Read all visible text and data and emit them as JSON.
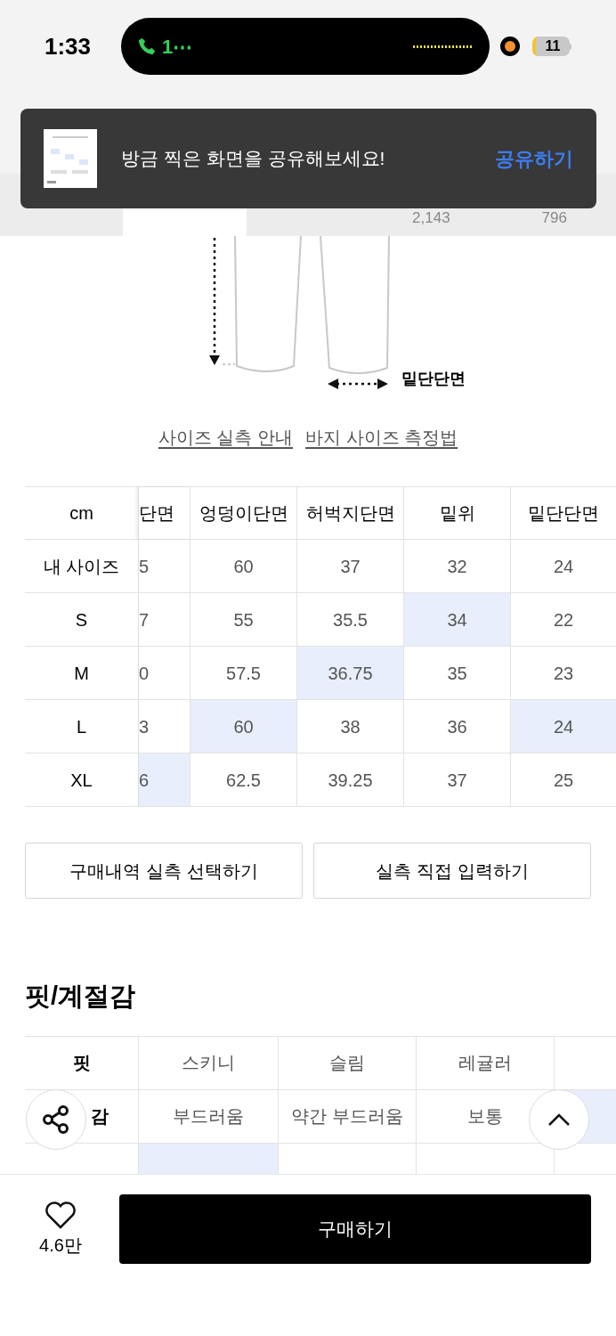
{
  "status_bar": {
    "time": "1:33",
    "call_text": "1⋯",
    "battery": "11"
  },
  "toast": {
    "message": "방금 찍은 화면을 공유해보세요!",
    "action": "공유하기"
  },
  "tabs": [
    {
      "selected": false
    },
    {
      "selected": true
    },
    {
      "selected": false
    },
    {
      "selected": false,
      "count": "2,143"
    },
    {
      "selected": false,
      "count": "796"
    }
  ],
  "diagram": {
    "label": "밑단단면"
  },
  "links": [
    "사이즈 실측 안내",
    "바지 사이즈 측정법"
  ],
  "size_table": {
    "corner": "cm",
    "columns": [
      "단면",
      "엉덩이단면",
      "허벅지단면",
      "밑위",
      "밑단단면"
    ],
    "rows": [
      {
        "label": "내 사이즈",
        "cells": [
          {
            "text": "5",
            "selected": false
          },
          {
            "text": "60",
            "selected": false
          },
          {
            "text": "37",
            "selected": false
          },
          {
            "text": "32",
            "selected": false
          },
          {
            "text": "24",
            "selected": false
          }
        ]
      },
      {
        "label": "S",
        "cells": [
          {
            "text": "7",
            "selected": false
          },
          {
            "text": "55",
            "selected": false
          },
          {
            "text": "35.5",
            "selected": false
          },
          {
            "text": "34",
            "selected": true
          },
          {
            "text": "22",
            "selected": false
          }
        ]
      },
      {
        "label": "M",
        "cells": [
          {
            "text": "0",
            "selected": false
          },
          {
            "text": "57.5",
            "selected": false
          },
          {
            "text": "36.75",
            "selected": true
          },
          {
            "text": "35",
            "selected": false
          },
          {
            "text": "23",
            "selected": false
          }
        ]
      },
      {
        "label": "L",
        "cells": [
          {
            "text": "3",
            "selected": false
          },
          {
            "text": "60",
            "selected": true
          },
          {
            "text": "38",
            "selected": false
          },
          {
            "text": "36",
            "selected": false
          },
          {
            "text": "24",
            "selected": true
          }
        ]
      },
      {
        "label": "XL",
        "cells": [
          {
            "text": "6",
            "selected": true
          },
          {
            "text": "62.5",
            "selected": false
          },
          {
            "text": "39.25",
            "selected": false
          },
          {
            "text": "37",
            "selected": false
          },
          {
            "text": "25",
            "selected": false
          }
        ]
      }
    ]
  },
  "actions": [
    "구매내역 실측 선택하기",
    "실측 직접 입력하기"
  ],
  "fit_section": {
    "title": "핏/계절감",
    "rows": [
      {
        "label": "핏",
        "cells": [
          {
            "text": "스키니",
            "selected": false
          },
          {
            "text": "슬림",
            "selected": false
          },
          {
            "text": "레귤러",
            "selected": false
          },
          {
            "selected": false
          }
        ]
      },
      {
        "label": "감",
        "cells": [
          {
            "text": "부드러움",
            "selected": false
          },
          {
            "text": "약간 부드러움",
            "selected": false
          },
          {
            "text": "보통",
            "selected": false
          },
          {
            "selected": true
          }
        ]
      },
      {
        "cells": [
          {
            "selected": true
          },
          {
            "selected": false
          },
          {
            "selected": false
          },
          {
            "selected": false
          }
        ]
      }
    ]
  },
  "bottom_bar": {
    "like_count": "4.6만",
    "buy_button": "구매하기"
  }
}
